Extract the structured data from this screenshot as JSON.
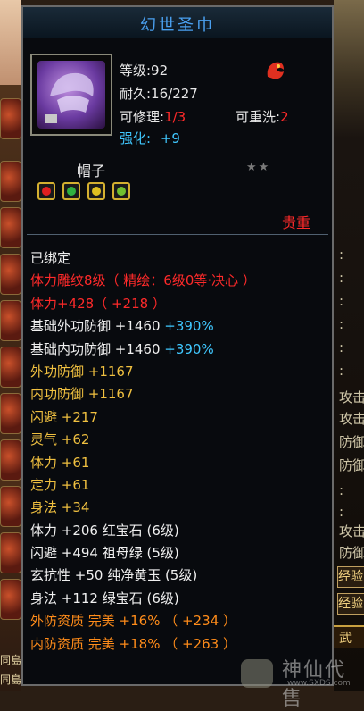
{
  "tooltip": {
    "title": "幻世圣巾",
    "level": "等级:92",
    "durability": "耐久:16/227",
    "repair_label": "可修理:",
    "repair_value": "1/3",
    "rewash_label": "可重洗:",
    "rewash_value": "2",
    "enhance_label": "强化:",
    "enhance_value": "+9",
    "item_type": "帽子",
    "stars": "★★",
    "precious": "贵重",
    "gem_colors": [
      "#e02020",
      "#30b040",
      "#e0c020",
      "#70c030"
    ]
  },
  "attributes": [
    {
      "text": "已绑定",
      "style": "white"
    },
    {
      "text": "体力雕纹8级（ 精绘：6级0等·决心 ）",
      "style": "red"
    },
    {
      "text": "体力+428（ +218 ）",
      "style": "red"
    },
    {
      "text": "基础外功防御 +1460 ",
      "extra": "+390%",
      "style": "white"
    },
    {
      "text": "基础内功防御 +1460 ",
      "extra": "+390%",
      "style": "white"
    },
    {
      "text": "外功防御 +1167",
      "style": "gold"
    },
    {
      "text": "内功防御 +1167",
      "style": "gold"
    },
    {
      "text": "闪避 +217",
      "style": "gold"
    },
    {
      "text": "灵气 +62",
      "style": "gold"
    },
    {
      "text": "体力 +61",
      "style": "gold"
    },
    {
      "text": "定力 +61",
      "style": "gold"
    },
    {
      "text": "身法 +34",
      "style": "gold"
    },
    {
      "text": "体力 +206 红宝石 (6级)",
      "style": "white"
    },
    {
      "text": "闪避 +494 祖母绿 (5级)",
      "style": "white"
    },
    {
      "text": "玄抗性 +50 纯净黄玉 (5级)",
      "style": "white"
    },
    {
      "text": "身法 +112 绿宝石 (6级)",
      "style": "white"
    },
    {
      "text": "外防资质  完美 +16% （ +234 ）",
      "style": "orange"
    },
    {
      "text": "内防资质  完美 +18% （ +263 ）",
      "style": "orange"
    }
  ],
  "background_right": {
    "labels": [
      ":",
      ":",
      ":",
      ":",
      ":",
      ":",
      "攻击",
      "攻击",
      "防御",
      "防御",
      ":",
      ":",
      "攻击",
      "防御"
    ],
    "buttons": [
      "经验",
      "经验"
    ],
    "bar_text": "武"
  },
  "background_left": {
    "bottom_text": [
      "同島",
      "同島"
    ]
  },
  "watermark": {
    "title": "神仙代售",
    "site": "www.SXDS.com"
  }
}
